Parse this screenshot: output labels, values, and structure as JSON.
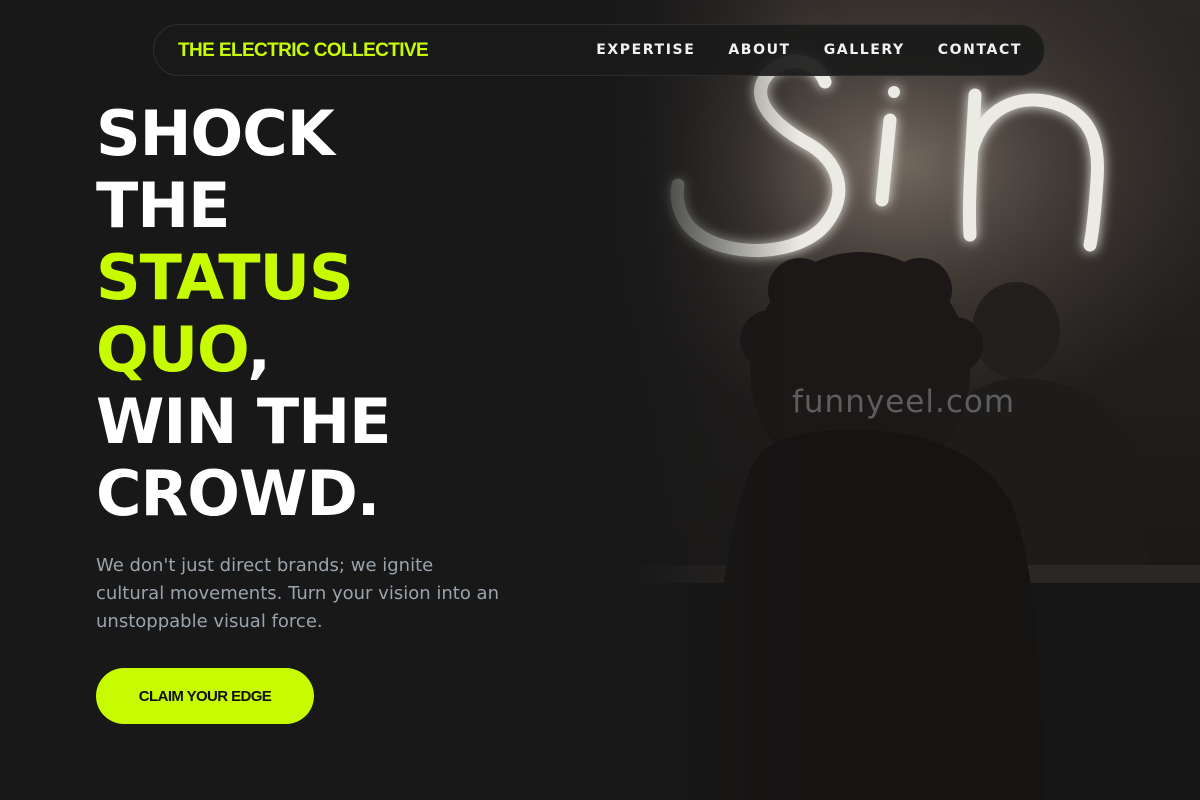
{
  "brand": {
    "name": "THE ELECTRIC COLLECTIVE",
    "accent_color": "#c6fb00"
  },
  "nav": {
    "links": [
      {
        "label": "EXPERTISE"
      },
      {
        "label": "ABOUT"
      },
      {
        "label": "GALLERY"
      },
      {
        "label": "CONTACT"
      }
    ]
  },
  "hero": {
    "title_lines": [
      {
        "text": "SHOCK",
        "suffix": ""
      },
      {
        "text": "THE",
        "suffix": ""
      },
      {
        "text": "STATUS",
        "suffix": ""
      },
      {
        "text": "QUO",
        "suffix": ","
      },
      {
        "text": "WIN THE",
        "suffix": ""
      },
      {
        "text": "CROWD.",
        "suffix": ""
      }
    ],
    "subtitle": "We don't just direct brands; we ignite cultural movements. Turn your vision into an unstoppable visual force.",
    "cta_label": "CLAIM YOUR EDGE"
  },
  "photo": {
    "neon_sign_text": "Sin"
  },
  "watermark": "funnyeel.com"
}
